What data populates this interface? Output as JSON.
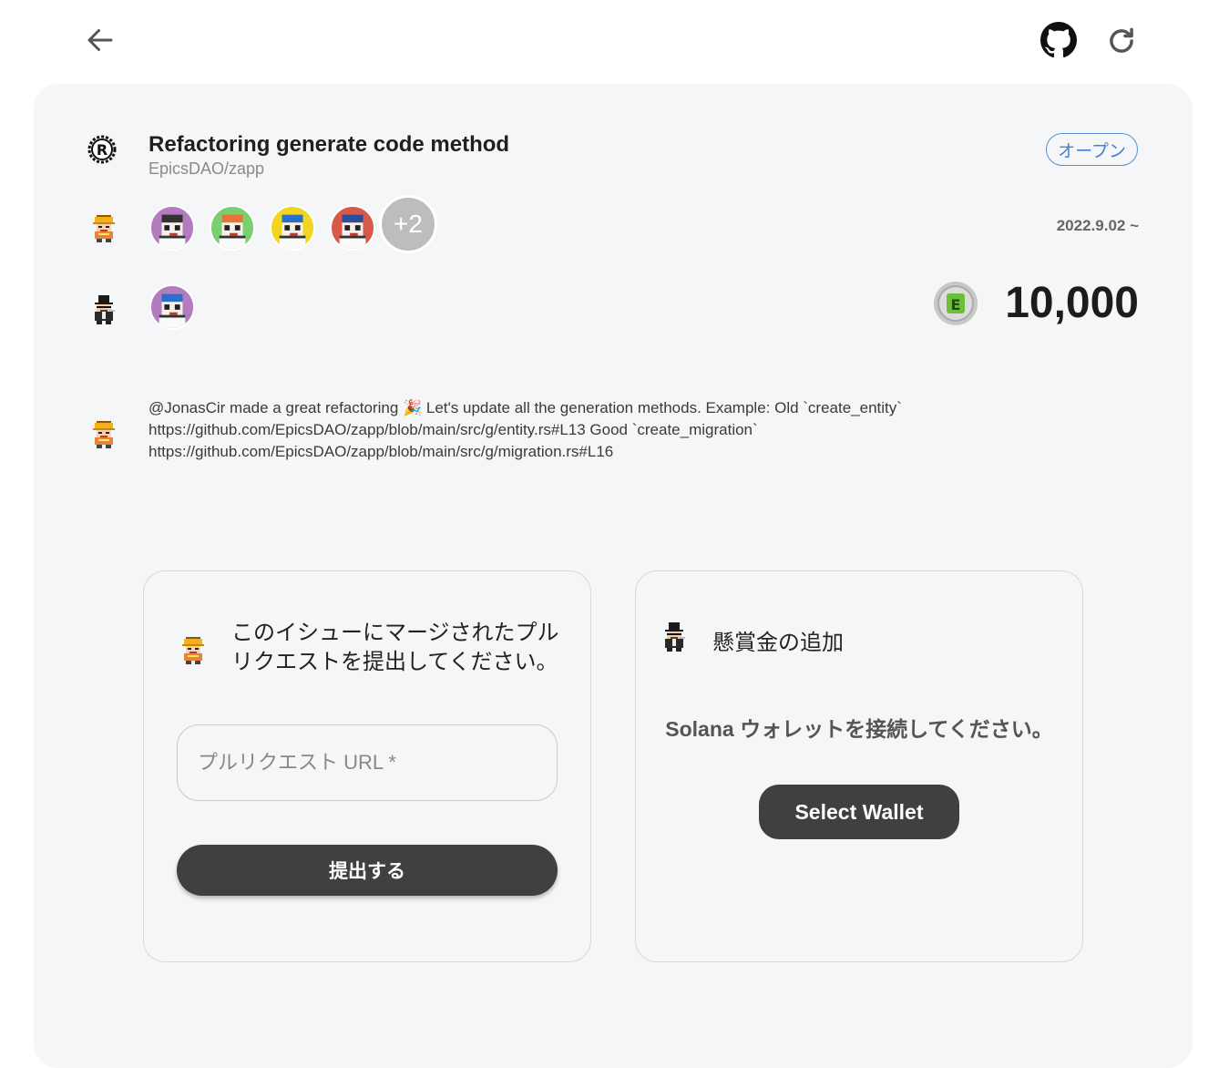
{
  "nav": {
    "back_icon": "arrow-left-icon",
    "github_icon": "github-icon",
    "reload_icon": "reload-icon"
  },
  "issue": {
    "title": "Refactoring generate code method",
    "repo": "EpicsDAO/zapp",
    "status": "オープン",
    "date": "2022.9.02 ~",
    "more_contributors": "+2",
    "bounty_amount": "10,000",
    "description_lines": [
      "@JonasCir made a great refactoring 🎉 Let's update all the generation methods. Example: Old `create_entity`",
      "https://github.com/EpicsDAO/zapp/blob/main/src/g/entity.rs#L13 Good `create_migration`",
      "https://github.com/EpicsDAO/zapp/blob/main/src/g/migration.rs#L16"
    ]
  },
  "pr_card": {
    "title": "このイシューにマージされたプルリクエストを提出してください。",
    "input_placeholder": "プルリクエスト URL *",
    "submit_label": "提出する"
  },
  "bounty_card": {
    "title": "懸賞金の追加",
    "connect_message": "Solana ウォレットを接続してください。",
    "wallet_button": "Select Wallet"
  },
  "colors": {
    "panel_bg": "#f5f6f8",
    "badge_blue": "#4a7fd0",
    "button_dark": "#404040"
  }
}
